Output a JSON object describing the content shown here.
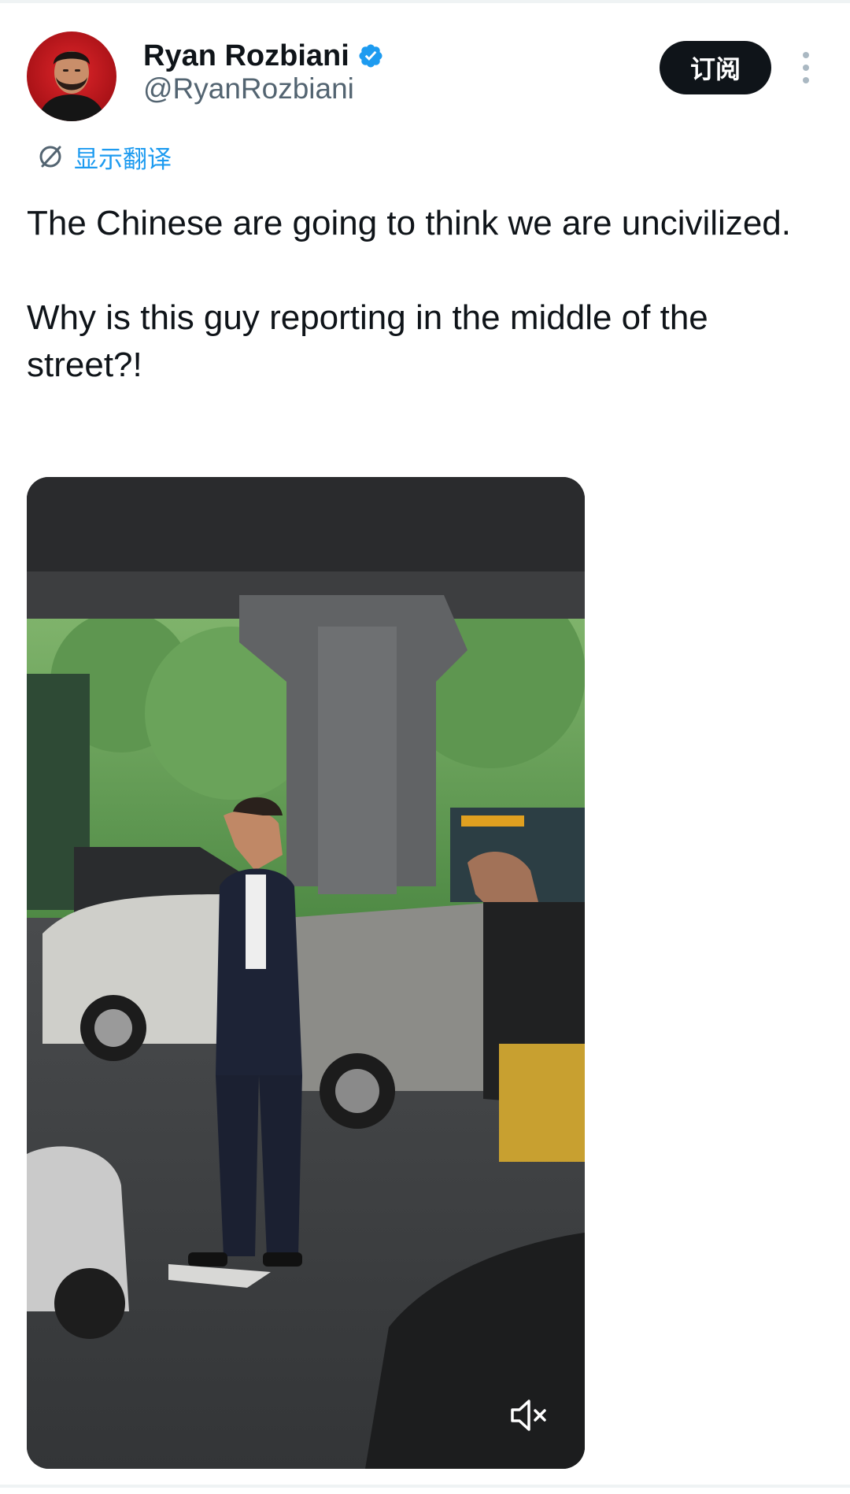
{
  "post": {
    "author": {
      "display_name": "Ryan Rozbiani",
      "handle": "@RyanRozbiani",
      "verified": true,
      "avatar_icon": "avatar-photo"
    },
    "subscribe_label": "订阅",
    "more_icon": "more-vertical-icon",
    "translate": {
      "icon": "translate-icon",
      "label": "显示翻译"
    },
    "text": {
      "paragraph_1": "The Chinese are going to think we are uncivilized.",
      "paragraph_2": "Why is this guy reporting in the middle of the street?!"
    },
    "media": {
      "type": "video",
      "muted": true,
      "mute_icon": "volume-muted-icon"
    }
  },
  "colors": {
    "accent": "#1d9bf0",
    "text_primary": "#0f1419",
    "text_secondary": "#536471",
    "button_dark": "#0f1419",
    "divider": "#eff3f4"
  }
}
